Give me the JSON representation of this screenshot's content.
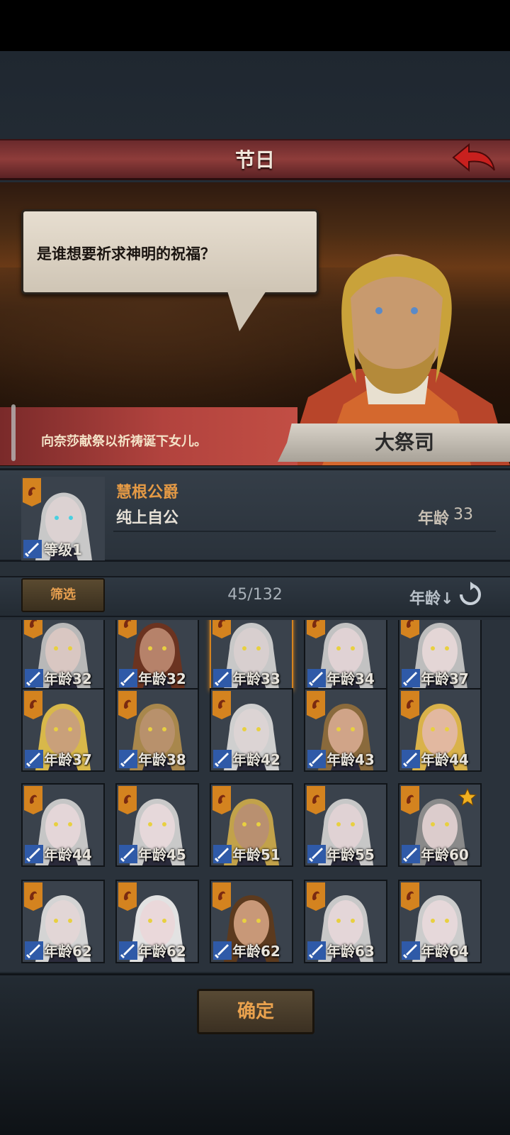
{
  "header": {
    "title": "节日"
  },
  "scene": {
    "speech": "是谁想要祈求神明的祝福？",
    "event_desc": "向奈莎献祭以祈祷诞下女儿。",
    "npc_name": "大祭司"
  },
  "selected": {
    "name": "慧根公爵",
    "title": "纯上自公",
    "age_label": "年龄",
    "age": "33",
    "level_label": "等级1"
  },
  "filter": {
    "button_label": "筛选",
    "count": "45/132",
    "sort_label": "年龄↓"
  },
  "grid": {
    "cards": [
      {
        "age": "年龄32",
        "hair": "#b8b8b8",
        "skin": "#d9c7c2",
        "star": false
      },
      {
        "age": "年龄32",
        "hair": "#6b3320",
        "skin": "#b6826a",
        "star": false
      },
      {
        "age": "年龄33",
        "hair": "#c8c8c8",
        "skin": "#d8cfcf",
        "star": false,
        "selected": true
      },
      {
        "age": "年龄34",
        "hair": "#c2c2c2",
        "skin": "#e0d2d4",
        "star": false
      },
      {
        "age": "年龄37",
        "hair": "#bdbdbd",
        "skin": "#e4d6d6",
        "star": false
      },
      {
        "age": "年龄37",
        "hair": "#d8b84a",
        "skin": "#c9a07a",
        "star": false
      },
      {
        "age": "年龄38",
        "hair": "#a8874c",
        "skin": "#b8916c",
        "star": false
      },
      {
        "age": "年龄42",
        "hair": "#cfcfcf",
        "skin": "#dcd4d4",
        "star": false
      },
      {
        "age": "年龄43",
        "hair": "#8a6a3c",
        "skin": "#d0a488",
        "star": false
      },
      {
        "age": "年龄44",
        "hair": "#d9b24a",
        "skin": "#e2b8a0",
        "star": false
      },
      {
        "age": "年龄44",
        "hair": "#c6c6c6",
        "skin": "#e4d6d8",
        "star": false
      },
      {
        "age": "年龄45",
        "hair": "#c9c9c9",
        "skin": "#e6d8da",
        "star": false
      },
      {
        "age": "年龄51",
        "hair": "#c2a24a",
        "skin": "#b99070",
        "star": false
      },
      {
        "age": "年龄55",
        "hair": "#c7c7c7",
        "skin": "#e0d2d4",
        "star": false
      },
      {
        "age": "年龄60",
        "hair": "#8a8a8a",
        "skin": "#dccccc",
        "star": true
      },
      {
        "age": "年龄62",
        "hair": "#d4d4d4",
        "skin": "#e2d6d6",
        "star": false
      },
      {
        "age": "年龄62",
        "hair": "#e2e2e2",
        "skin": "#ead8da",
        "star": false
      },
      {
        "age": "年龄62",
        "hair": "#5c3a1e",
        "skin": "#c89878",
        "star": false
      },
      {
        "age": "年龄63",
        "hair": "#c8c8c8",
        "skin": "#e4d6d8",
        "star": false
      },
      {
        "age": "年龄64",
        "hair": "#cccccc",
        "skin": "#e6d8da",
        "star": false
      }
    ]
  },
  "footer": {
    "confirm_label": "确定"
  },
  "colors": {
    "accent_orange": "#e59a45",
    "header_red": "#8e3c3a",
    "badge_orange": "#d4831f",
    "sword_blue": "#2f5aa8"
  }
}
